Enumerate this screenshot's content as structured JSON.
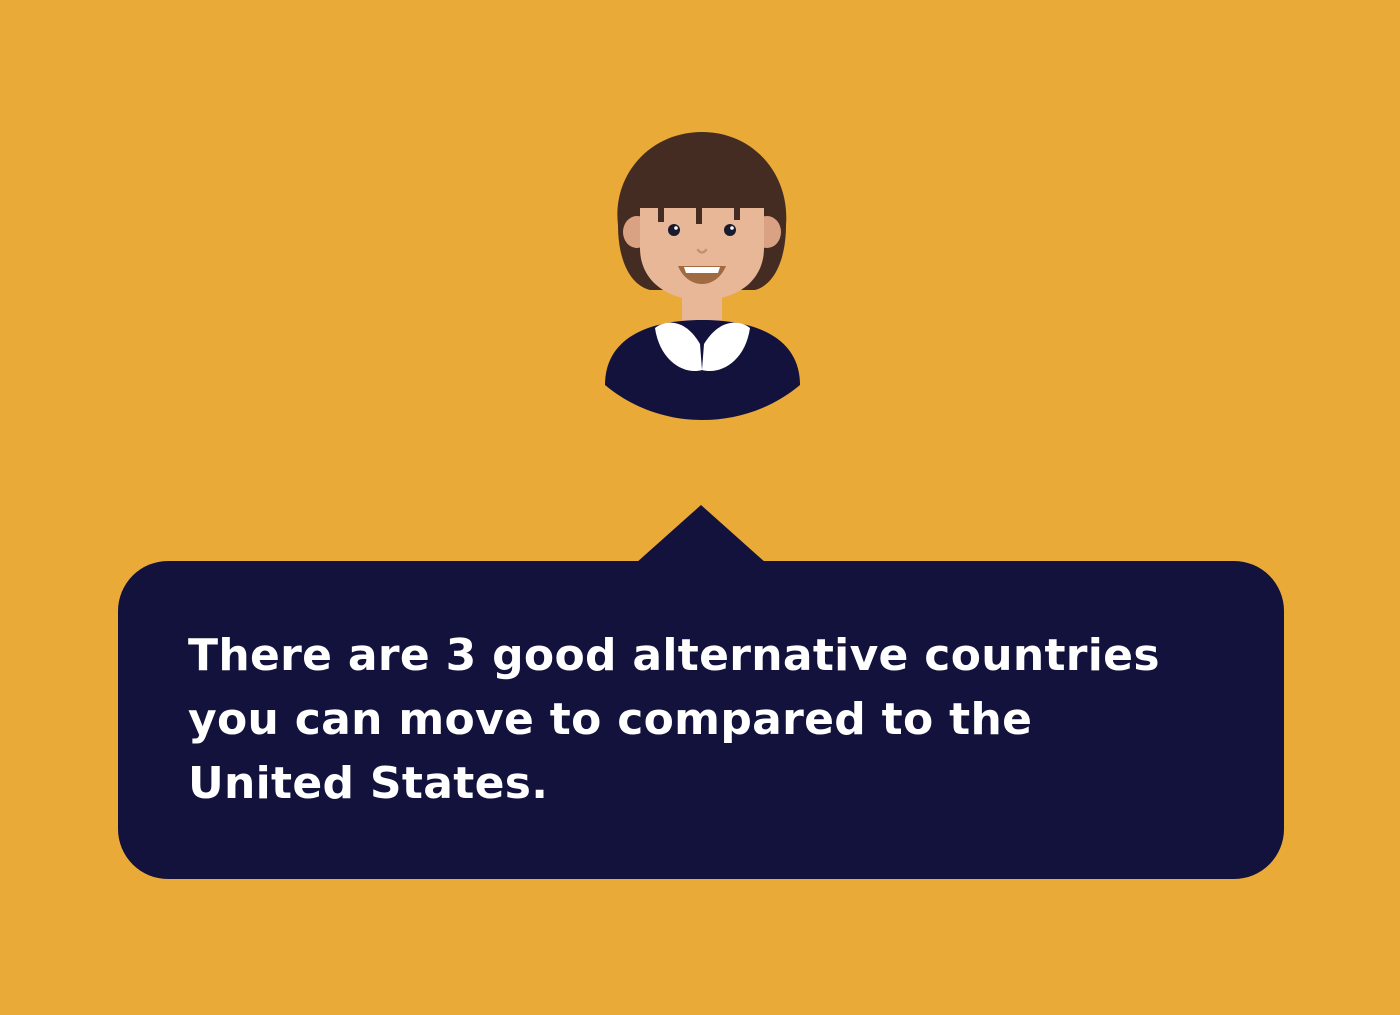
{
  "colors": {
    "background": "#EAAA37",
    "bubble": "#12123C",
    "text": "#FFFFFF",
    "hair": "#452C22",
    "skin": "#E8B798",
    "shirt": "#12123C",
    "collar": "#FFFFFF"
  },
  "avatar": {
    "icon": "smiling-girl-avatar-icon"
  },
  "bubble": {
    "text": "There are 3 good alternative countries you can move to compared to the United States."
  }
}
